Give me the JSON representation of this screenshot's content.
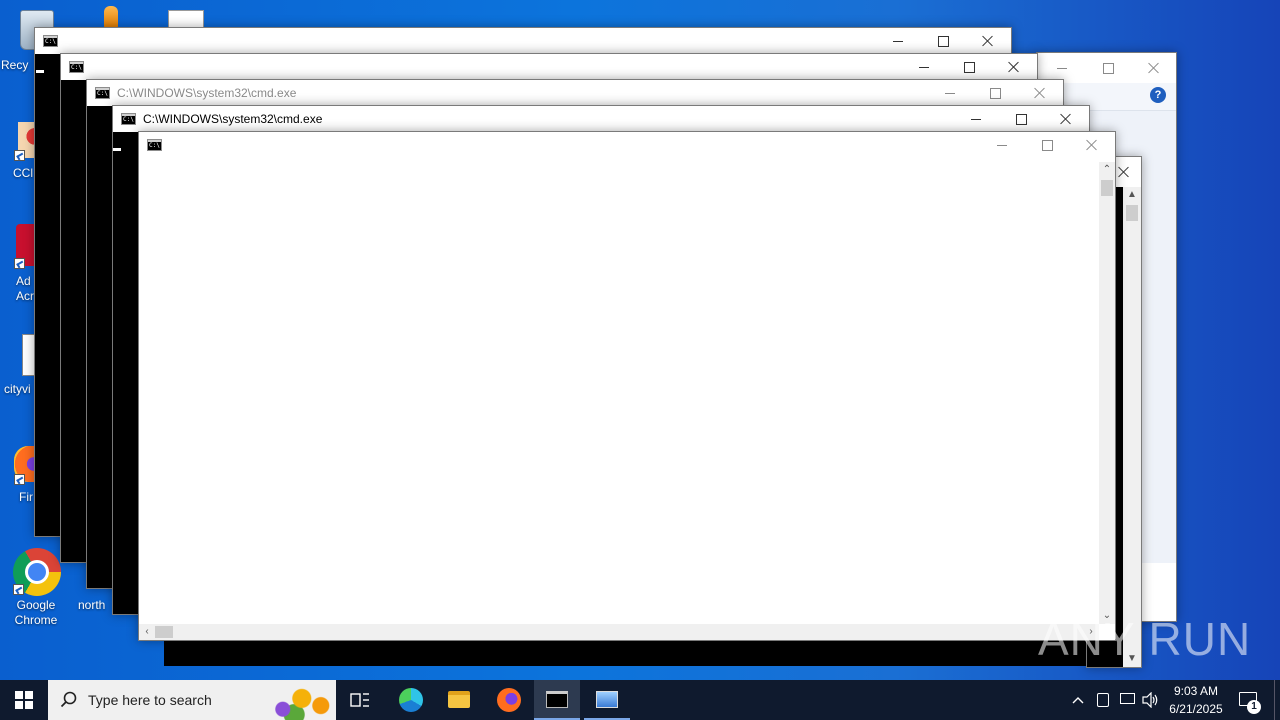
{
  "desktop": {
    "icons": [
      {
        "label": "Recy"
      },
      {
        "label": "CCl"
      },
      {
        "label": "Ad\nAcr"
      },
      {
        "label": "cityvi"
      },
      {
        "label": "Fir"
      },
      {
        "label": "Google\nChrome"
      },
      {
        "label": "north"
      }
    ]
  },
  "windows": {
    "cmd1": {
      "title": ""
    },
    "cmd2": {
      "title": ""
    },
    "cmd3": {
      "title": "C:\\WINDOWS\\system32\\cmd.exe"
    },
    "cmd4": {
      "title": "C:\\WINDOWS\\system32\\cmd.exe"
    },
    "cmd5": {
      "title": ""
    }
  },
  "taskbar": {
    "search_placeholder": "Type here to search",
    "clock_time": "9:03 AM",
    "clock_date": "6/21/2025",
    "notification_count": "1"
  },
  "watermark": "ANY RUN",
  "colors": {
    "desktop": "#0c74dc",
    "taskbar": "#0f1a2e",
    "console": "#000000"
  }
}
